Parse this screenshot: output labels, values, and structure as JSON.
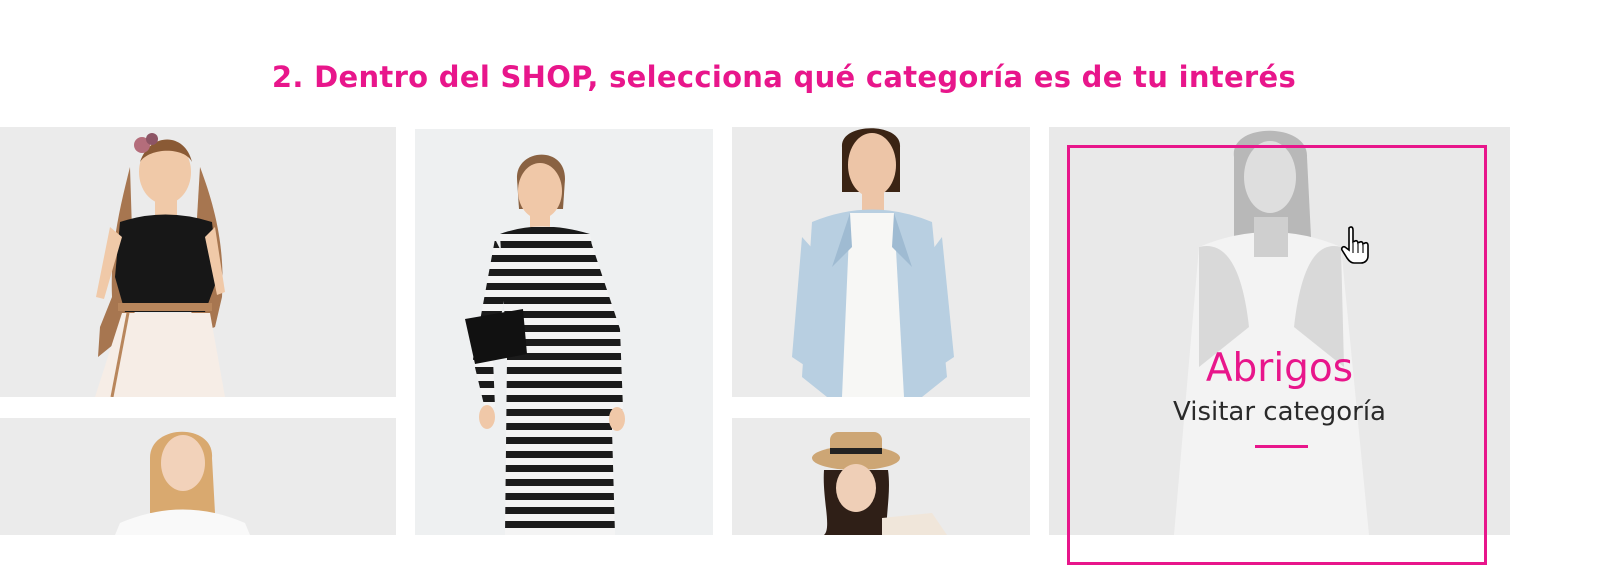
{
  "step": {
    "number": "2.",
    "text": "Dentro del SHOP, selecciona qué categoría es de tu interés"
  },
  "featured": {
    "title": "Abrigos",
    "link": "Visitar categoría"
  },
  "colors": {
    "accent": "#e8168b",
    "tile_bg": "#ebebeb"
  },
  "icons": {
    "cursor": "hand-pointer-icon"
  }
}
